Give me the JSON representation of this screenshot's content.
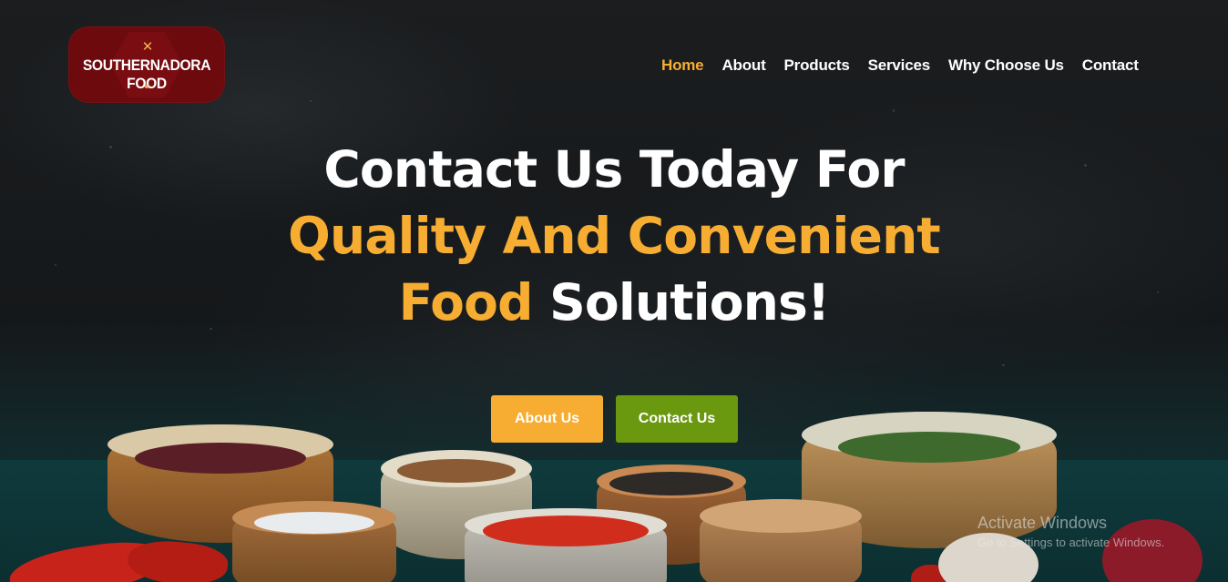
{
  "brand": {
    "logo_text": "SOUTHERNADORA FOOD"
  },
  "nav": {
    "items": [
      {
        "label": "Home",
        "active": true
      },
      {
        "label": "About",
        "active": false
      },
      {
        "label": "Products",
        "active": false
      },
      {
        "label": "Services",
        "active": false
      },
      {
        "label": "Why Choose Us",
        "active": false
      },
      {
        "label": "Contact",
        "active": false
      }
    ]
  },
  "hero": {
    "line1": "Contact Us Today For",
    "line2_highlight": "Quality And Convenient",
    "line3_highlight": "Food",
    "line3_rest": "Solutions!",
    "buttons": {
      "about": "About Us",
      "contact": "Contact Us"
    }
  },
  "watermark": {
    "title": "Activate Windows",
    "subtitle": "Go to Settings to activate Windows."
  },
  "colors": {
    "accent": "#f6ad32",
    "secondary": "#6a980f",
    "logo_bg": "#6c0a0d"
  }
}
